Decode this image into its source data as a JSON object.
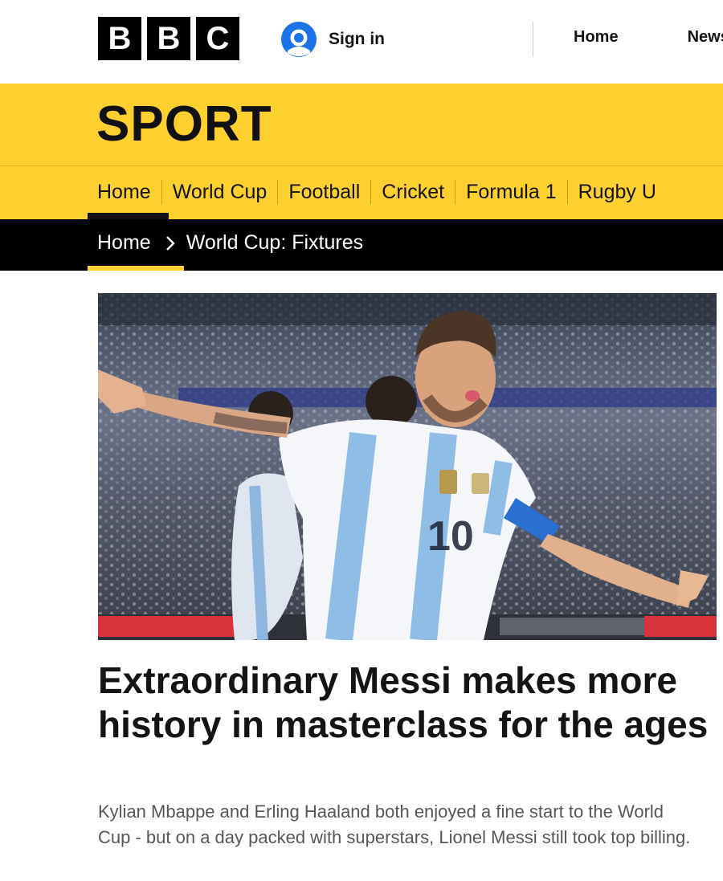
{
  "masthead": {
    "logo_letters": [
      "B",
      "B",
      "C"
    ],
    "signin_label": "Sign in",
    "user_icon": "user-account-icon",
    "nav": [
      "Home",
      "News"
    ]
  },
  "sport": {
    "title": "SPORT",
    "brand_color": "#fdd02f"
  },
  "section_nav": {
    "items": [
      "Home",
      "World Cup",
      "Football",
      "Cricket",
      "Formula 1",
      "Rugby U"
    ],
    "active": "Home"
  },
  "breadcrumb": {
    "items": [
      "Home",
      "World Cup: Fixtures"
    ],
    "separator_icon": "chevron-right-icon"
  },
  "article": {
    "headline": "Extraordinary Messi makes more history in masterclass for the ages",
    "summary": "Kylian Mbappe and Erling Haaland both enjoyed a fine start to the World Cup - but on a day packed with superstars, Lionel Messi still took top billing."
  }
}
